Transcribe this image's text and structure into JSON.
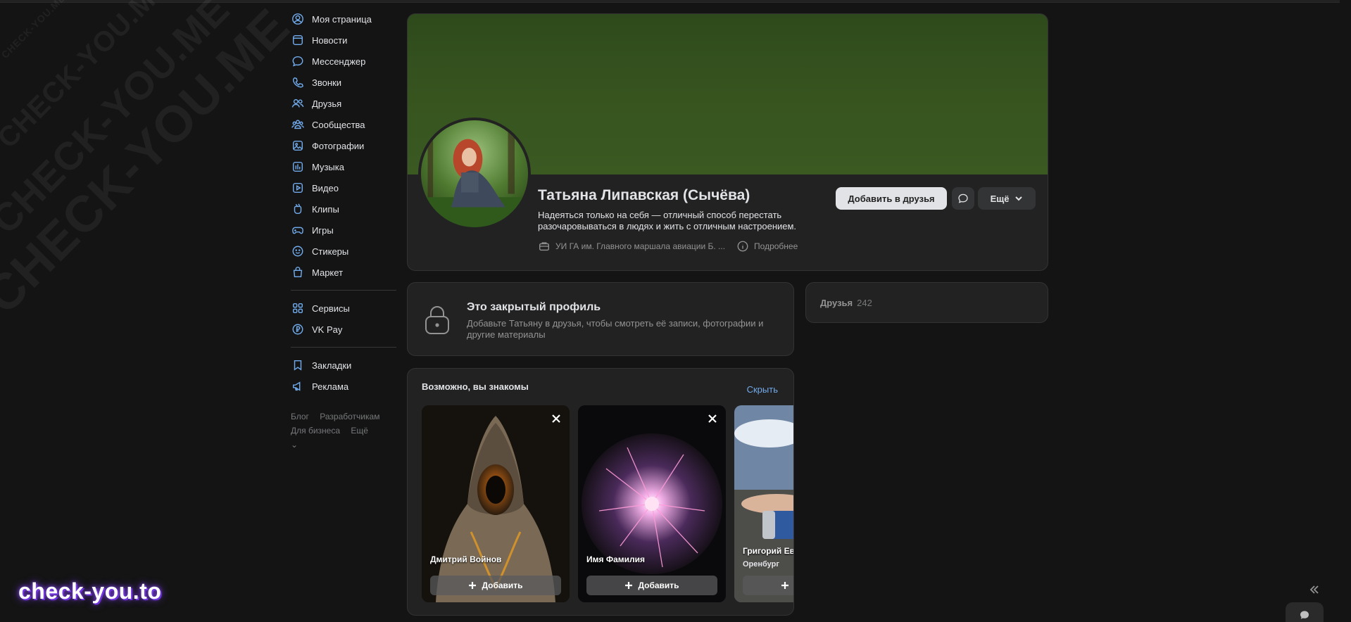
{
  "brand": "check-you.to",
  "watermark": "CHECK-YOU.ME",
  "sidebar": {
    "items": [
      {
        "label": "Моя страница",
        "icon": "user-circle-icon"
      },
      {
        "label": "Новости",
        "icon": "news-icon"
      },
      {
        "label": "Мессенджер",
        "icon": "message-icon"
      },
      {
        "label": "Звонки",
        "icon": "phone-icon"
      },
      {
        "label": "Друзья",
        "icon": "friends-icon"
      },
      {
        "label": "Сообщества",
        "icon": "communities-icon"
      },
      {
        "label": "Фотографии",
        "icon": "photo-icon"
      },
      {
        "label": "Музыка",
        "icon": "music-icon"
      },
      {
        "label": "Видео",
        "icon": "video-icon"
      },
      {
        "label": "Клипы",
        "icon": "clips-icon"
      },
      {
        "label": "Игры",
        "icon": "gamepad-icon"
      },
      {
        "label": "Стикеры",
        "icon": "sticker-icon"
      },
      {
        "label": "Маркет",
        "icon": "market-bag-icon"
      }
    ],
    "items2": [
      {
        "label": "Сервисы",
        "icon": "services-icon"
      },
      {
        "label": "VK Pay",
        "icon": "vkpay-icon"
      }
    ],
    "items3": [
      {
        "label": "Закладки",
        "icon": "bookmark-icon"
      },
      {
        "label": "Реклама",
        "icon": "megaphone-icon"
      }
    ],
    "footer": [
      "Блог",
      "Разработчикам",
      "Для бизнеса",
      "Ещё"
    ]
  },
  "profile": {
    "name": "Татьяна Липавская (Сычёва)",
    "status": "Надеяться только на себя — отличный способ перестать разочаровываться в людях и жить с отличным настроением.",
    "work": "УИ ГА им. Главного маршала авиации Б. ...",
    "details": "Подробнее",
    "add_friend": "Добавить в друзья",
    "more": "Ещё"
  },
  "closed": {
    "title": "Это закрытый профиль",
    "desc": "Добавьте Татьяну в друзья, чтобы смотреть её записи, фотографии и другие материалы"
  },
  "friends": {
    "label": "Друзья",
    "count": "242"
  },
  "suggest": {
    "title": "Возможно, вы знакомы",
    "hide": "Скрыть",
    "add_label": "Добавить",
    "people": [
      {
        "name": "Дмитрий Войнов",
        "city": ""
      },
      {
        "name": "Имя Фамилия",
        "city": ""
      },
      {
        "name": "Григорий Ев",
        "city": "Оренбург"
      }
    ]
  }
}
